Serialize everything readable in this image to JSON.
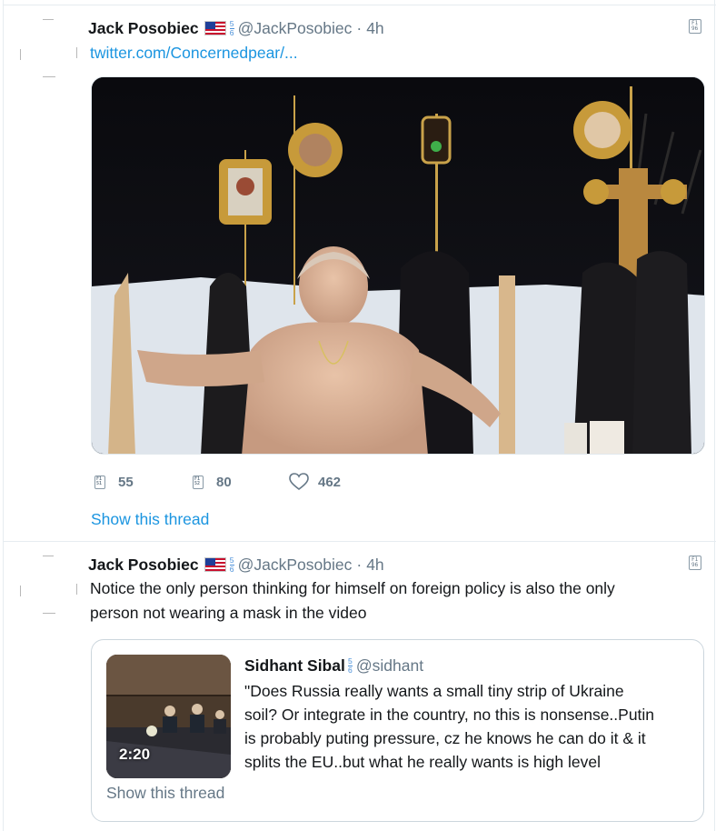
{
  "tweets": [
    {
      "author_name": "Jack Posobiec",
      "flag": "us-flag-icon",
      "badge_top": "5",
      "badge_bottom": "6",
      "handle": "@JackPosobiec",
      "separator": "·",
      "time": "4h",
      "link_text": "twitter.com/Concernedpear/...",
      "media": "photo",
      "actions": {
        "reply_count": "55",
        "retweet_count": "80",
        "like_count": "462"
      },
      "show_thread": "Show this thread"
    },
    {
      "author_name": "Jack Posobiec",
      "flag": "us-flag-icon",
      "badge_top": "5",
      "badge_bottom": "6",
      "handle": "@JackPosobiec",
      "separator": "·",
      "time": "4h",
      "text_line1": "Notice the only person thinking for himself on foreign policy is also the only",
      "text_line2": "person not wearing a mask in the video",
      "quote": {
        "author_name": "Sidhant Sibal",
        "badge_top": "5",
        "badge_bottom": "6",
        "handle": "@sidhant",
        "video_duration": "2:20",
        "text_line1": "\"Does Russia really wants a small tiny strip of Ukraine",
        "text_line2": "soil? Or integrate in the country, no this is nonsense..Putin",
        "text_line3": "is probably puting pressure, cz he knows he can do it & it",
        "text_line4": "splits the EU..but what he really wants is high level",
        "show_thread": "Show this thread"
      }
    }
  ],
  "placeholder_glyph": {
    "line1": "F1",
    "line_caret": "96",
    "line_reply": "51",
    "line_rt": "52"
  },
  "colors": {
    "link": "#1b95e0",
    "secondary_text": "#657786",
    "border": "#e6ecf0"
  }
}
